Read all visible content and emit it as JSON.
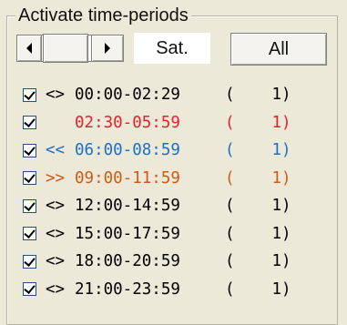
{
  "group": {
    "title": "Activate time-periods"
  },
  "nav": {
    "day_label": "Sat.",
    "all_label": "All"
  },
  "colors": {
    "default": "#000000",
    "red": "#e8202a",
    "blue": "#1d6fc4",
    "orange": "#cc5b16"
  },
  "periods": [
    {
      "checked": true,
      "symbol": "<>",
      "time": "00:00-02:29",
      "open": "(",
      "count": "1",
      "close": ")",
      "color": "#000000"
    },
    {
      "checked": true,
      "symbol": "",
      "time": "02:30-05:59",
      "open": "(",
      "count": "1",
      "close": ")",
      "color": "#e8202a"
    },
    {
      "checked": true,
      "symbol": "<<",
      "time": "06:00-08:59",
      "open": "(",
      "count": "1",
      "close": ")",
      "color": "#1d6fc4"
    },
    {
      "checked": true,
      "symbol": ">>",
      "time": "09:00-11:59",
      "open": "(",
      "count": "1",
      "close": ")",
      "color": "#cc5b16"
    },
    {
      "checked": true,
      "symbol": "<>",
      "time": "12:00-14:59",
      "open": "(",
      "count": "1",
      "close": ")",
      "color": "#000000"
    },
    {
      "checked": true,
      "symbol": "<>",
      "time": "15:00-17:59",
      "open": "(",
      "count": "1",
      "close": ")",
      "color": "#000000"
    },
    {
      "checked": true,
      "symbol": "<>",
      "time": "18:00-20:59",
      "open": "(",
      "count": "1",
      "close": ")",
      "color": "#000000"
    },
    {
      "checked": true,
      "symbol": "<>",
      "time": "21:00-23:59",
      "open": "(",
      "count": "1",
      "close": ")",
      "color": "#000000"
    }
  ]
}
